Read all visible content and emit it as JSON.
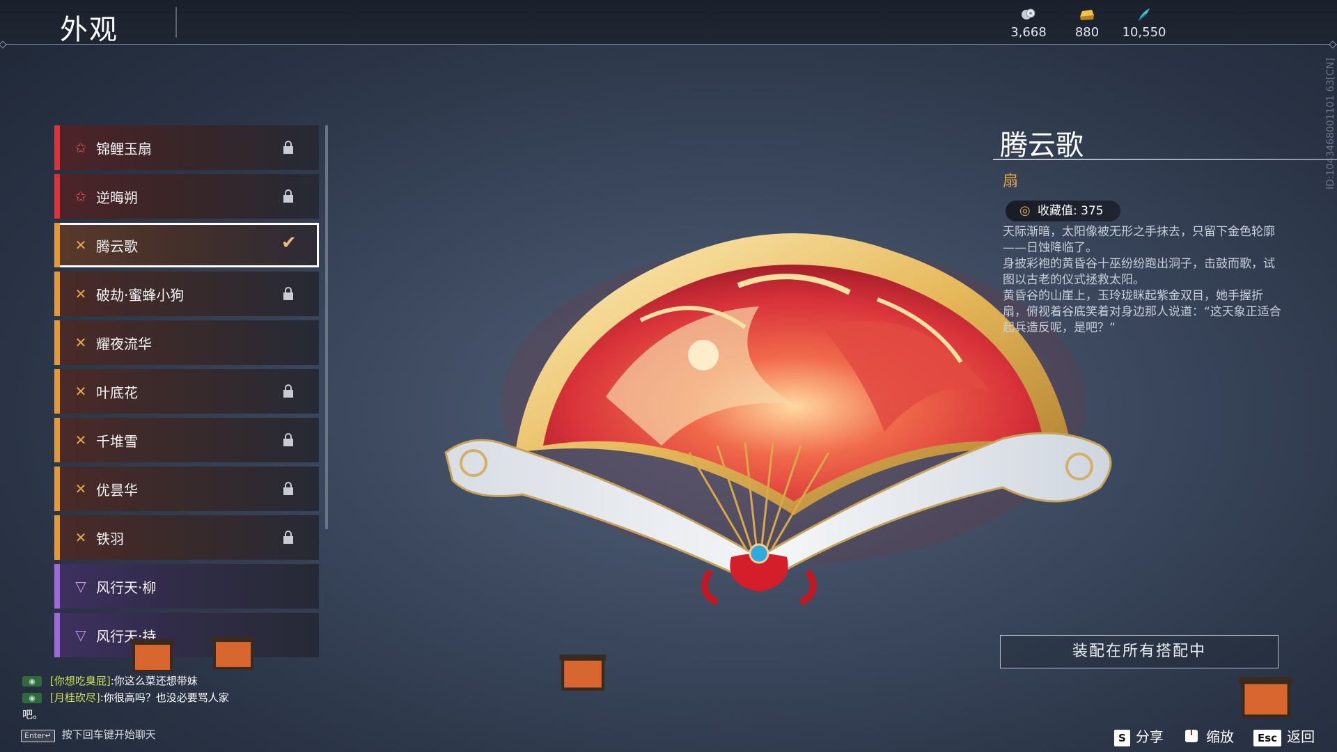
{
  "header": {
    "title": "外观",
    "currencies": [
      {
        "icon": "coin-icon",
        "value": "3,668"
      },
      {
        "icon": "gold-ingot-icon",
        "value": "880"
      },
      {
        "icon": "feather-icon",
        "value": "10,550"
      }
    ]
  },
  "side_id": "ID:1043468001101 63[CN]",
  "list": {
    "items": [
      {
        "label": "锦鲤玉扇",
        "quality": "red",
        "locked": true,
        "selected": false
      },
      {
        "label": "逆晦朔",
        "quality": "red",
        "locked": true,
        "selected": false
      },
      {
        "label": "腾云歌",
        "quality": "orange",
        "locked": false,
        "selected": true
      },
      {
        "label": "破劫·蜜蜂小狗",
        "quality": "orange",
        "locked": true,
        "selected": false
      },
      {
        "label": "耀夜流华",
        "quality": "orange",
        "locked": false,
        "selected": false
      },
      {
        "label": "叶底花",
        "quality": "orange",
        "locked": true,
        "selected": false
      },
      {
        "label": "千堆雪",
        "quality": "orange",
        "locked": true,
        "selected": false
      },
      {
        "label": "优昙华",
        "quality": "orange",
        "locked": true,
        "selected": false
      },
      {
        "label": "铁羽",
        "quality": "orange",
        "locked": true,
        "selected": false
      },
      {
        "label": "风行天·柳",
        "quality": "purple",
        "locked": false,
        "selected": false
      },
      {
        "label": "风行天·持",
        "quality": "purple",
        "locked": false,
        "selected": false
      }
    ]
  },
  "detail": {
    "name": "腾云歌",
    "type": "扇",
    "collection_label": "收藏值: 375",
    "description": [
      "天际渐暗，太阳像被无形之手抹去，只留下金色轮廓——日蚀降临了。",
      "身披彩袍的黄昏谷十巫纷纷跑出洞子，击鼓而歌，试图以古老的仪式拯救太阳。",
      "黄昏谷的山崖上，玉玲珑眯起紫金双目，她手握折扇，俯视着谷底笑着对身边那人说道：“这天象正适合起兵造反呢，是吧？”"
    ],
    "equip_button": "装配在所有搭配中"
  },
  "chat": {
    "messages": [
      {
        "badge": "world",
        "name": "[你想吃臭屁]",
        "text": ":你这么菜还想带妹"
      },
      {
        "badge": "world",
        "name": "[月桂砍尽]",
        "text": ":你很高吗？也没必要骂人家"
      }
    ],
    "continuation": "吧。",
    "enter_key": "Enter↵",
    "hint": "按下回车键开始聊天"
  },
  "keyhints": [
    {
      "key": "S",
      "label": "分享"
    },
    {
      "key": "mouse-icon",
      "label": "缩放"
    },
    {
      "key": "Esc",
      "label": "返回"
    }
  ],
  "colors": {
    "quality_red": "#d9343b",
    "quality_orange": "#e39a3a",
    "quality_purple": "#9b6ad8",
    "accent_gold": "#e8a94a"
  }
}
